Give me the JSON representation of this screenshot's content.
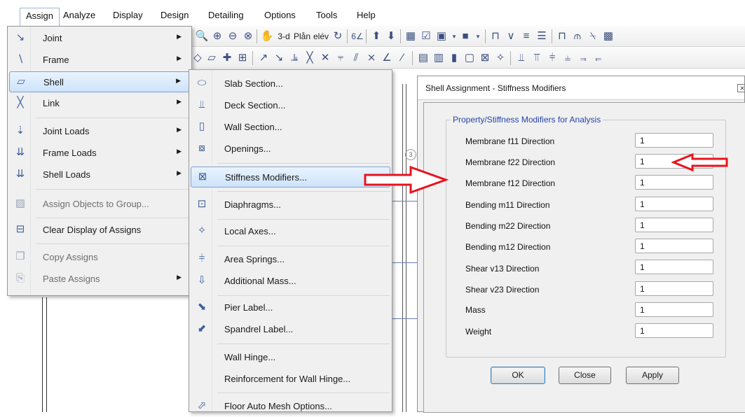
{
  "menubar": {
    "items": [
      {
        "label": "Assign"
      },
      {
        "label": "Analyze"
      },
      {
        "label": "Display"
      },
      {
        "label": "Design"
      },
      {
        "label": "Detailing"
      },
      {
        "label": "Options"
      },
      {
        "label": "Tools"
      },
      {
        "label": "Help"
      }
    ]
  },
  "toolbar1": {
    "threed_label": "3-d",
    "plan_label": "Plån",
    "elev_label": "elév"
  },
  "assign_menu": {
    "items": [
      {
        "label": "Joint",
        "icon": "joint-icon",
        "enabled": true,
        "submenu": true
      },
      {
        "label": "Frame",
        "icon": "frame-icon",
        "enabled": true,
        "submenu": true
      },
      {
        "label": "Shell",
        "icon": "shell-icon",
        "enabled": true,
        "submenu": true,
        "highlighted": true
      },
      {
        "label": "Link",
        "icon": "link-icon",
        "enabled": true,
        "submenu": true
      },
      {
        "label": "Joint Loads",
        "icon": "joint-loads-icon",
        "enabled": true,
        "submenu": true
      },
      {
        "label": "Frame Loads",
        "icon": "frame-loads-icon",
        "enabled": true,
        "submenu": true
      },
      {
        "label": "Shell Loads",
        "icon": "shell-loads-icon",
        "enabled": true,
        "submenu": true
      },
      {
        "label": "Assign Objects to Group...",
        "icon": "group-icon",
        "enabled": false,
        "submenu": false
      },
      {
        "label": "Clear Display of Assigns",
        "icon": "clear-display-icon",
        "enabled": true,
        "submenu": false
      },
      {
        "label": "Copy Assigns",
        "icon": "copy-icon",
        "enabled": false,
        "submenu": false
      },
      {
        "label": "Paste Assigns",
        "icon": "paste-icon",
        "enabled": false,
        "submenu": true
      }
    ]
  },
  "shell_menu": {
    "items": [
      {
        "label": "Slab Section...",
        "icon": "slab-section-icon"
      },
      {
        "label": "Deck Section...",
        "icon": "deck-section-icon"
      },
      {
        "label": "Wall Section...",
        "icon": "wall-section-icon"
      },
      {
        "label": "Openings...",
        "icon": "openings-icon"
      },
      {
        "label": "Stiffness Modifiers...",
        "icon": "stiffness-modifiers-icon",
        "highlighted": true
      },
      {
        "label": "Diaphragms...",
        "icon": "diaphragms-icon"
      },
      {
        "label": "Local Axes...",
        "icon": "local-axes-icon"
      },
      {
        "label": "Area Springs...",
        "icon": "area-springs-icon"
      },
      {
        "label": "Additional Mass...",
        "icon": "additional-mass-icon"
      },
      {
        "label": "Pier Label...",
        "icon": "pier-label-icon"
      },
      {
        "label": "Spandrel Label...",
        "icon": "spandrel-label-icon"
      },
      {
        "label": "Wall Hinge...",
        "icon": ""
      },
      {
        "label": "Reinforcement for Wall Hinge...",
        "icon": ""
      },
      {
        "label": "Floor Auto Mesh Options...",
        "icon": "floor-mesh-icon"
      }
    ]
  },
  "dialog": {
    "title": "Shell Assignment - Stiffness Modifiers",
    "close_glyph": "⨯",
    "group_title": "Property/Stiffness Modifiers for Analysis",
    "rows": [
      {
        "label": "Membrane f11 Direction",
        "value": "1"
      },
      {
        "label": "Membrane f22 Direction",
        "value": "1"
      },
      {
        "label": "Membrane f12 Direction",
        "value": "1"
      },
      {
        "label": "Bending m11 Direction",
        "value": "1"
      },
      {
        "label": "Bending m22 Direction",
        "value": "1"
      },
      {
        "label": "Bending m12 Direction",
        "value": "1"
      },
      {
        "label": "Shear v13 Direction",
        "value": "1"
      },
      {
        "label": "Shear v23 Direction",
        "value": "1"
      },
      {
        "label": "Mass",
        "value": "1"
      },
      {
        "label": "Weight",
        "value": "1"
      }
    ],
    "buttons": {
      "ok": "OK",
      "close": "Close",
      "apply": "Apply"
    }
  },
  "canvas": {
    "bubble_label": "3"
  },
  "colors": {
    "annotation_arrow": "#e8131c",
    "menu_highlight": "#cde3fa",
    "group_title": "#2445a8"
  }
}
